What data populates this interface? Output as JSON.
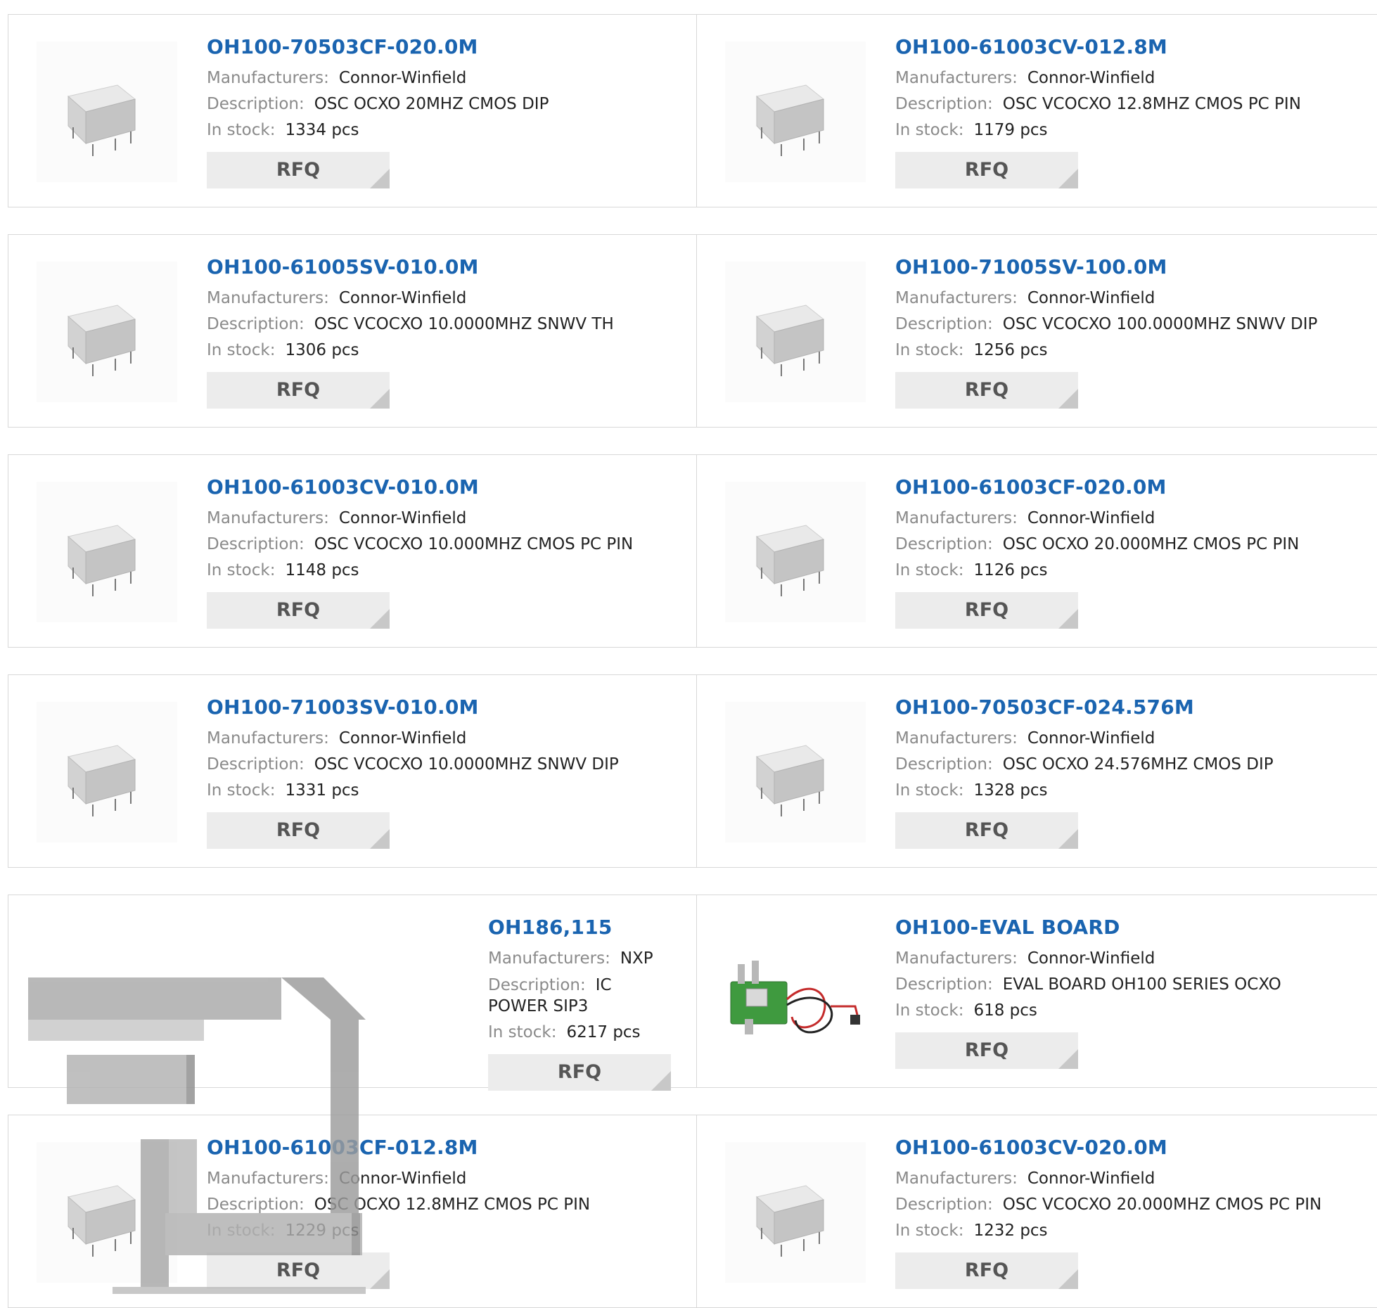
{
  "labels": {
    "manufacturers": "Manufacturers:",
    "description": "Description:",
    "stock": "In stock:",
    "rfq": "RFQ",
    "pcs_suffix": "pcs"
  },
  "rows": [
    {
      "left": {
        "part": "OH100-70503CF-020.0M",
        "manufacturer": "Connor-Winfield",
        "description": "OSC OCXO 20MHZ CMOS DIP",
        "stock": "1334 pcs"
      },
      "right": {
        "part": "OH100-61003CV-012.8M",
        "manufacturer": "Connor-Winfield",
        "description": "OSC VCOCXO 12.8MHZ CMOS PC PIN",
        "stock": "1179 pcs"
      }
    },
    {
      "left": {
        "part": "OH100-61005SV-010.0M",
        "manufacturer": "Connor-Winfield",
        "description": "OSC VCOCXO 10.0000MHZ SNWV TH",
        "stock": "1306 pcs"
      },
      "right": {
        "part": "OH100-71005SV-100.0M",
        "manufacturer": "Connor-Winfield",
        "description": "OSC VCOCXO 100.0000MHZ SNWV DIP",
        "stock": "1256 pcs"
      }
    },
    {
      "left": {
        "part": "OH100-61003CV-010.0M",
        "manufacturer": "Connor-Winfield",
        "description": "OSC VCOCXO 10.000MHZ CMOS PC PIN",
        "stock": "1148 pcs"
      },
      "right": {
        "part": "OH100-61003CF-020.0M",
        "manufacturer": "Connor-Winfield",
        "description": "OSC OCXO 20.000MHZ CMOS PC PIN",
        "stock": "1126 pcs"
      }
    },
    {
      "left": {
        "part": "OH100-71003SV-010.0M",
        "manufacturer": "Connor-Winfield",
        "description": "OSC VCOCXO 10.0000MHZ SNWV DIP",
        "stock": "1331 pcs"
      },
      "right": {
        "part": "OH100-70503CF-024.576M",
        "manufacturer": "Connor-Winfield",
        "description": "OSC OCXO 24.576MHZ CMOS DIP",
        "stock": "1328 pcs"
      }
    },
    {
      "left": {
        "part": "OH186,115",
        "manufacturer": "NXP",
        "description": "IC POWER SIP3",
        "stock": "6217 pcs"
      },
      "right": {
        "part": "OH100-EVAL BOARD",
        "manufacturer": "Connor-Winfield",
        "description": "EVAL BOARD OH100 SERIES OCXO",
        "stock": "618 pcs"
      }
    },
    {
      "left": {
        "part": "OH100-61003CF-012.8M",
        "manufacturer": "Connor-Winfield",
        "description": "OSC OCXO 12.8MHZ CMOS PC PIN",
        "stock": "1229 pcs"
      },
      "right": {
        "part": "OH100-61003CV-020.0M",
        "manufacturer": "Connor-Winfield",
        "description": "OSC VCOCXO 20.000MHZ CMOS PC PIN",
        "stock": "1232 pcs"
      }
    }
  ],
  "colors": {
    "part_link": "#1a64b0",
    "label": "#8a8a8a",
    "rfq_bg": "#ececec"
  }
}
